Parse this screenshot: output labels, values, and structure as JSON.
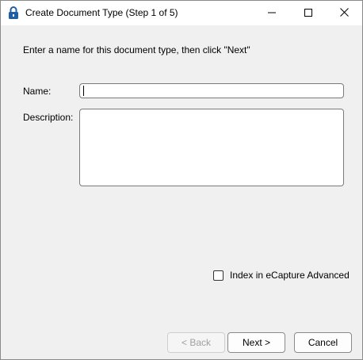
{
  "window": {
    "title": "Create Document Type (Step 1 of 5)",
    "icon": "padlock-icon",
    "controls": {
      "minimize": "minimize-icon",
      "maximize": "maximize-icon",
      "close": "close-icon"
    }
  },
  "form": {
    "instruction": "Enter a name for this document type, then click \"Next\"",
    "name_label": "Name:",
    "name_value": "",
    "description_label": "Description:",
    "description_value": "",
    "index_checkbox_label": "Index in eCapture Advanced",
    "index_checkbox_checked": false
  },
  "buttons": {
    "back": "< Back",
    "back_enabled": false,
    "next": "Next >",
    "cancel": "Cancel"
  },
  "colors": {
    "window_bg": "#f0f0f0",
    "titlebar_bg": "#ffffff",
    "icon_blue": "#1f5fa8",
    "disabled_text": "#a0a0a0"
  }
}
